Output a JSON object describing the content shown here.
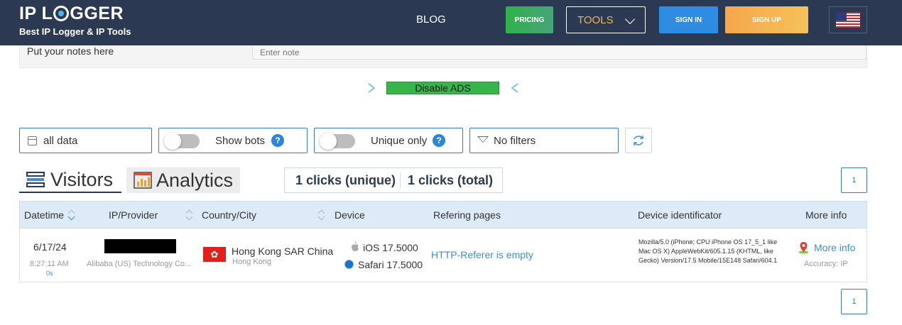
{
  "header": {
    "logo_left": "IP L",
    "logo_right": "GGER",
    "tagline": "Best IP Logger & IP Tools",
    "nav_blog": "BLOG",
    "pricing": "PRICING",
    "tools": "TOOLS",
    "sign_in": "SIGN IN",
    "sign_up": "SIGN UP"
  },
  "notes": {
    "label": "Put your notes here",
    "placeholder": "Enter note"
  },
  "ads": {
    "label": "Disable ADS"
  },
  "filters": {
    "date": "all data",
    "show_bots": "Show bots",
    "unique_only": "Unique only",
    "help": "?",
    "no_filters": "No filters"
  },
  "tabs": {
    "visitors": "Visitors",
    "analytics": "Analytics"
  },
  "clicks": {
    "unique": "1 clicks (unique)",
    "total": "1 clicks (total)"
  },
  "pagination": {
    "page": "1"
  },
  "table": {
    "columns": [
      "Datetime",
      "IP/Provider",
      "Country/City",
      "Device",
      "Refering pages",
      "Device identificator",
      "More info"
    ],
    "row": {
      "date": "6/17/24",
      "time": "8:27:11 AM",
      "duration": "0s",
      "provider": "Alibaba (US) Technology Co...",
      "country": "Hong Kong SAR China",
      "city": "Hong Kong",
      "os": "iOS 17.5000",
      "browser": "Safari 17.5000",
      "referer": "HTTP-Referer is empty",
      "user_agent": "Mozilla/5.0 (iPhone; CPU iPhone OS 17_5_1 like Mac OS X) AppleWebKit/605.1.15 (KHTML, like Gecko) Version/17.5 Mobile/15E148 Safari/604.1",
      "more_info": "More info",
      "accuracy": "Accuracy: IP"
    }
  },
  "colors": {
    "header_bg": "#2b3a52",
    "accent_blue": "#3a8fd8",
    "pricing_green": "#2fb24a",
    "signup_orange": "#f7a64b",
    "ads_green": "#38b54a"
  }
}
